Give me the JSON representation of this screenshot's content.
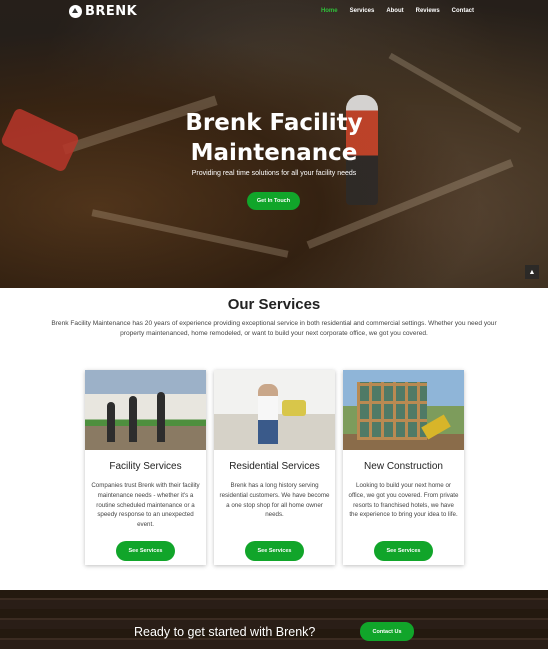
{
  "brand": {
    "logo_text": "BRENK"
  },
  "nav": {
    "items": [
      "Home",
      "Services",
      "About",
      "Reviews",
      "Contact"
    ],
    "active": "Home"
  },
  "hero": {
    "title_line1": "Brenk Facility",
    "title_line2": "Maintenance",
    "subtitle": "Providing real time solutions for all your facility needs",
    "button_label": "Get In Touch",
    "scroll_top_icon": "chevron-up-icon"
  },
  "services": {
    "title": "Our Services",
    "intro": "Brenk Facility Maintenance has 20 years of experience providing exceptional service in both residential and commercial settings. Whether you need your property maintenanced, home remodeled, or want to build your next corporate office, we got you covered.",
    "cards": [
      {
        "title": "Facility Services",
        "text": "Companies trust Brenk with their facility maintenance needs - whether it's a routine scheduled maintenance or a speedy response to an unexpected event.",
        "button_label": "See Services"
      },
      {
        "title": "Residential Services",
        "text": "Brenk has a long history serving residential customers. We have become a one stop shop for all home owner needs.",
        "button_label": "See Services"
      },
      {
        "title": "New Construction",
        "text": "Looking to build your next home or office, we got you covered. From private resorts to franchised hotels, we have the experience to bring your idea to life.",
        "button_label": "See Services"
      }
    ]
  },
  "cta": {
    "text": "Ready to get started with Brenk?",
    "button_label": "Contact Us"
  },
  "colors": {
    "accent": "#11a52a",
    "nav_active": "#2fbf3a"
  }
}
